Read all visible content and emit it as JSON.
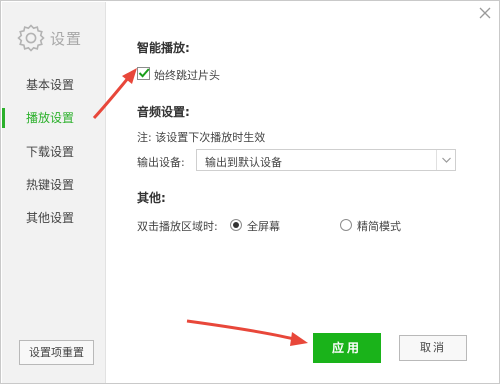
{
  "app": {
    "title": "设置"
  },
  "sidebar": {
    "items": [
      {
        "label": "基本设置",
        "active": false
      },
      {
        "label": "播放设置",
        "active": true
      },
      {
        "label": "下载设置",
        "active": false
      },
      {
        "label": "热键设置",
        "active": false
      },
      {
        "label": "其他设置",
        "active": false
      }
    ],
    "reset_label": "设置项重置"
  },
  "smart_play": {
    "title": "智能播放:",
    "skip_label": "始终跳过片头",
    "skip_checked": true
  },
  "audio": {
    "title": "音频设置:",
    "note": "注: 该设置下次播放时生效",
    "output_label": "输出设备:",
    "output_value": "输出到默认设备"
  },
  "other": {
    "title": "其他:",
    "dblclick_label": "双击播放区域时:",
    "options": [
      {
        "label": "全屏幕",
        "checked": true
      },
      {
        "label": "精简模式",
        "checked": false
      }
    ]
  },
  "footer": {
    "apply_label": "应用",
    "cancel_label": "取消"
  },
  "colors": {
    "accent": "#2bb02b",
    "apply_bg": "#1ab31a",
    "annotation_arrow": "#e8473a"
  },
  "icons": {
    "logo": "gear-icon",
    "close": "close-icon",
    "check": "checkmark-icon",
    "dropdown": "chevron-down-icon"
  }
}
